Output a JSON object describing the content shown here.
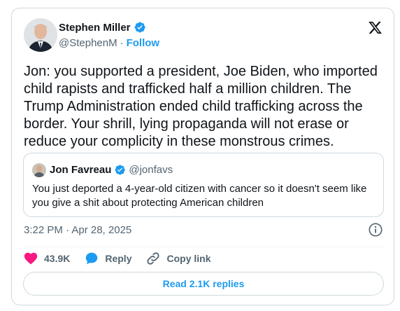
{
  "author": {
    "name": "Stephen Miller",
    "handle": "@StephenM",
    "separator": "·",
    "follow_label": "Follow"
  },
  "tweet": {
    "text": "Jon: you supported a president, Joe Biden, who imported child rapists and trafficked half a million children. The Trump Administration ended child trafficking across the border. Your shrill, lying propaganda will not erase or reduce your complicity in these monstrous crimes.",
    "timestamp": "3:22 PM · Apr 28, 2025"
  },
  "quoted": {
    "name": "Jon Favreau",
    "handle": "@jonfavs",
    "text": "You just deported a 4-year-old citizen with cancer so it doesn't seem like you give a shit about protecting American children"
  },
  "actions": {
    "likes": "43.9K",
    "reply_label": "Reply",
    "copy_label": "Copy link"
  },
  "replies_button": "Read 2.1K replies",
  "colors": {
    "accent": "#1d9bf0",
    "like": "#f91880",
    "text": "#0f1419",
    "muted": "#536471",
    "border": "#cfd9de"
  },
  "icons": [
    "verified-badge-icon",
    "x-logo-icon",
    "info-icon",
    "heart-icon",
    "reply-bubble-icon",
    "link-icon"
  ]
}
